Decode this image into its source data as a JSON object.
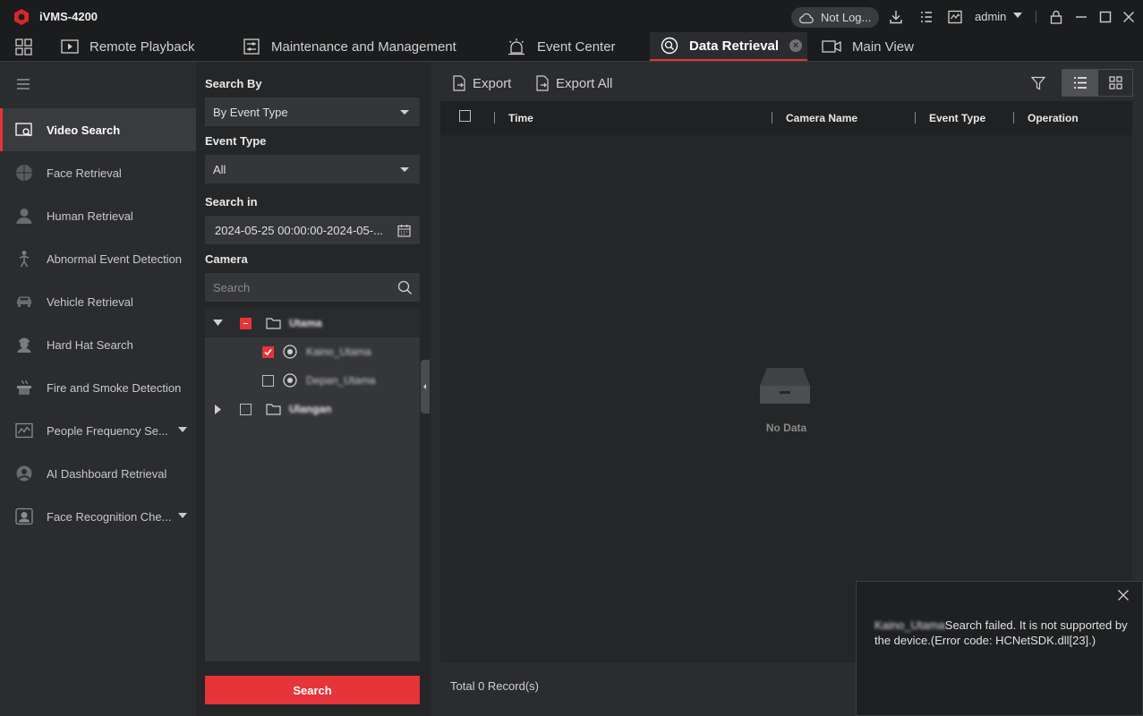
{
  "app": {
    "title": "iVMS-4200"
  },
  "titlebar": {
    "login_status": "Not Log...",
    "user": "admin"
  },
  "tabs": [
    {
      "label": "Remote Playback"
    },
    {
      "label": "Maintenance and Management"
    },
    {
      "label": "Event Center"
    },
    {
      "label": "Data Retrieval"
    },
    {
      "label": "Main View"
    }
  ],
  "sidebar": {
    "items": [
      {
        "label": "Video Search"
      },
      {
        "label": "Face Retrieval"
      },
      {
        "label": "Human Retrieval"
      },
      {
        "label": "Abnormal Event Detection"
      },
      {
        "label": "Vehicle Retrieval"
      },
      {
        "label": "Hard Hat Search"
      },
      {
        "label": "Fire and Smoke Detection"
      },
      {
        "label": "People Frequency Se..."
      },
      {
        "label": "AI Dashboard Retrieval"
      },
      {
        "label": "Face Recognition Che..."
      }
    ]
  },
  "search_panel": {
    "search_by_label": "Search By",
    "search_by_value": "By Event Type",
    "event_type_label": "Event Type",
    "event_type_value": "All",
    "search_in_label": "Search in",
    "search_in_value": "2024-05-25 00:00:00-2024-05-...",
    "camera_label": "Camera",
    "camera_search_placeholder": "Search",
    "tree": [
      {
        "label": "Utama"
      },
      {
        "label": "Kaino_Utama"
      },
      {
        "label": "Depan_Utama"
      },
      {
        "label": "Ulangan"
      }
    ],
    "search_button": "Search"
  },
  "main": {
    "export_label": "Export",
    "export_all_label": "Export All",
    "columns": [
      "Time",
      "Camera Name",
      "Event Type",
      "Operation"
    ],
    "empty_text": "No Data",
    "total": "Total 0 Record(s)"
  },
  "toast": {
    "camera": "Kaino_Utama",
    "message": "Search failed. It is not supported by the device.(Error code: HCNetSDK.dll[23].)"
  },
  "colors": {
    "accent": "#e5343a",
    "background": "#1b1c1e",
    "panel": "#2b2c2f"
  }
}
